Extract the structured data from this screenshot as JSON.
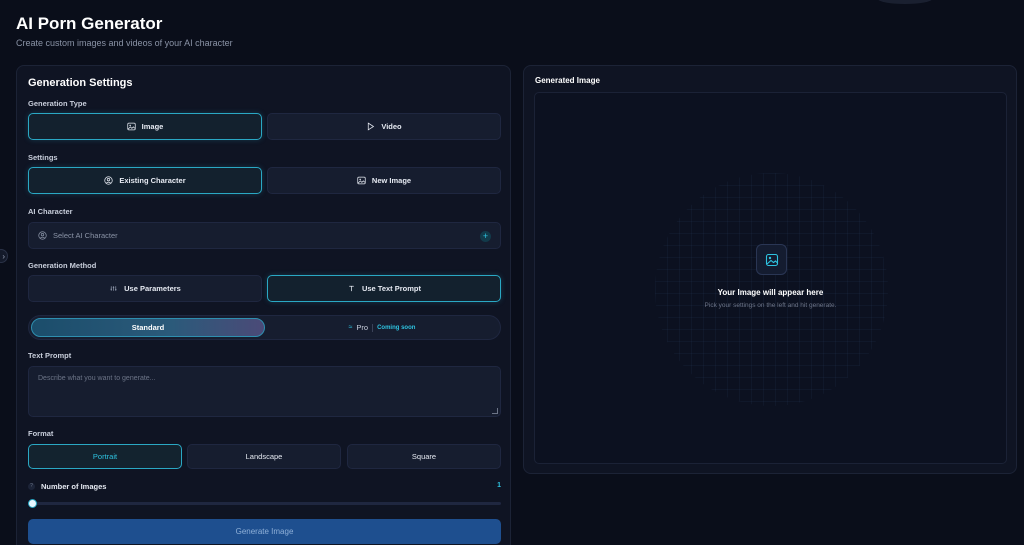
{
  "page": {
    "title": "AI Porn Generator",
    "subtitle": "Create custom images and videos of your AI character"
  },
  "settings": {
    "heading": "Generation Settings",
    "generation_type_label": "Generation Type",
    "type_image": "Image",
    "type_video": "Video",
    "settings_label": "Settings",
    "existing_character": "Existing Character",
    "new_image": "New Image",
    "ai_character_label": "AI Character",
    "select_character_placeholder": "Select AI Character",
    "generation_method_label": "Generation Method",
    "use_parameters": "Use Parameters",
    "use_text_prompt": "Use Text Prompt",
    "mode_standard": "Standard",
    "mode_pro": "Pro",
    "coming_soon": "Coming soon",
    "text_prompt_label": "Text Prompt",
    "prompt_placeholder": "Describe what you want to generate...",
    "format_label": "Format",
    "format_portrait": "Portrait",
    "format_landscape": "Landscape",
    "format_square": "Square",
    "number_of_images_label": "Number of Images",
    "number_of_images_value": "1",
    "generate_button": "Generate Image"
  },
  "preview": {
    "heading": "Generated Image",
    "empty_title": "Your Image will appear here",
    "empty_subtitle": "Pick your settings on the left and hit generate."
  },
  "colors": {
    "accent": "#2ec3e0",
    "background": "#0a0e1a",
    "panel": "#0f1423",
    "primary_button": "#1e4f8f"
  }
}
